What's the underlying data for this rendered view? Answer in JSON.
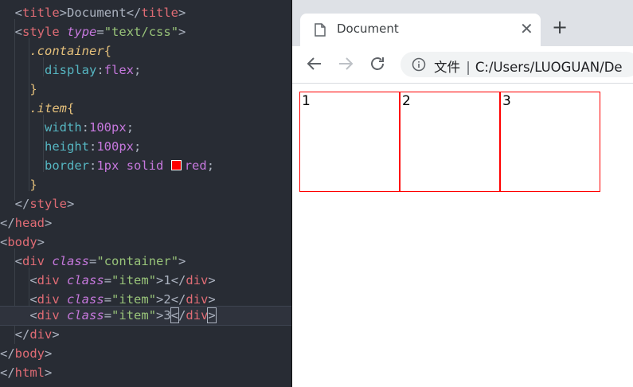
{
  "editor": {
    "lines": {
      "l1_open": "<",
      "l1_tag": "title",
      "l1_text": "Document",
      "l1_close_tag": "title",
      "l2_tag": "style",
      "l2_attr": "type",
      "l2_val": "\"text/css\"",
      "l3_sel": ".container",
      "l4_prop": "display",
      "l4_val": "flex",
      "l6_sel": ".item",
      "l7_prop": "width",
      "l7_val": "100px",
      "l8_prop": "height",
      "l8_val": "100px",
      "l9_prop": "border",
      "l9_v1": "1px",
      "l9_v2": "solid",
      "l9_v3": "red",
      "l11_tag": "style",
      "l12_tag": "head",
      "l13_tag": "body",
      "l14_tag": "div",
      "l14_attr": "class",
      "l14_val": "\"container\"",
      "l15_tag": "div",
      "l15_attr": "class",
      "l15_val": "\"item\"",
      "l15_text": "1",
      "l16_tag": "div",
      "l16_attr": "class",
      "l16_val": "\"item\"",
      "l16_text": "2",
      "l17_tag": "div",
      "l17_attr": "class",
      "l17_val": "\"item\"",
      "l17_text": "3",
      "l18_tag": "div",
      "l19_tag": "body",
      "l20_tag": "html"
    },
    "swatch_color": "#ff0000"
  },
  "browser": {
    "tab_title": "Document",
    "tab_close": "✕",
    "new_tab": "+",
    "address_prefix": "文件",
    "address_url": "C:/Users/LUOGUAN/De",
    "items": [
      "1",
      "2",
      "3"
    ]
  }
}
